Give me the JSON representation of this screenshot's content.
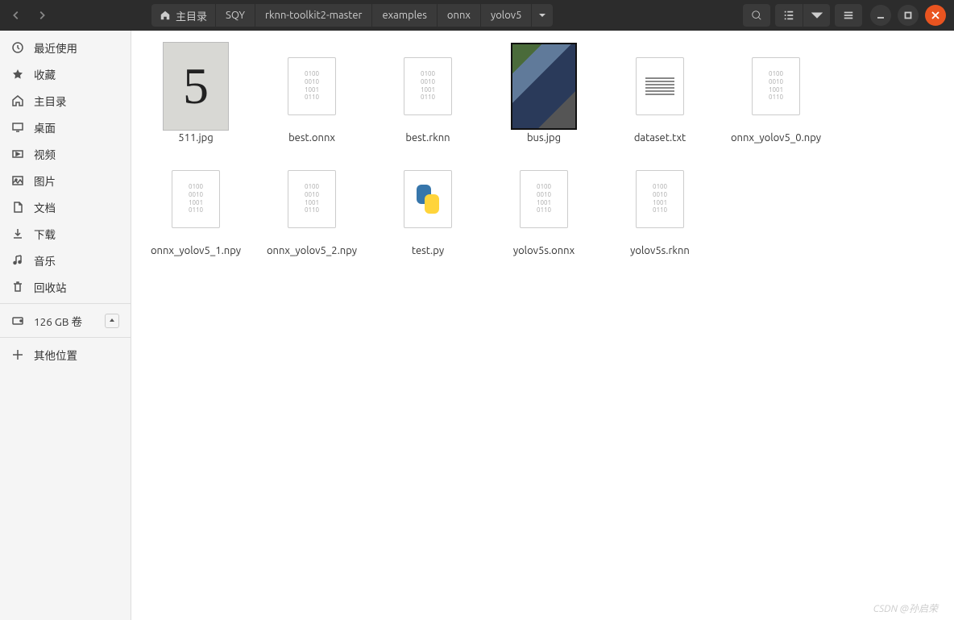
{
  "breadcrumb": {
    "home": "主目录",
    "items": [
      "SQY",
      "rknn-toolkit2-master",
      "examples",
      "onnx",
      "yolov5"
    ]
  },
  "sidebar": {
    "items": [
      {
        "id": "recent",
        "label": "最近使用",
        "icon": "clock"
      },
      {
        "id": "starred",
        "label": "收藏",
        "icon": "star"
      },
      {
        "id": "home",
        "label": "主目录",
        "icon": "home"
      },
      {
        "id": "desktop",
        "label": "桌面",
        "icon": "monitor"
      },
      {
        "id": "videos",
        "label": "视频",
        "icon": "video"
      },
      {
        "id": "pictures",
        "label": "图片",
        "icon": "image"
      },
      {
        "id": "documents",
        "label": "文档",
        "icon": "document"
      },
      {
        "id": "downloads",
        "label": "下载",
        "icon": "download"
      },
      {
        "id": "music",
        "label": "音乐",
        "icon": "music"
      },
      {
        "id": "trash",
        "label": "回收站",
        "icon": "trash"
      }
    ],
    "volume": {
      "label": "126 GB 卷",
      "icon": "disk"
    },
    "other": {
      "label": "其他位置",
      "icon": "plus"
    }
  },
  "files": [
    {
      "name": "511.jpg",
      "type": "image-5"
    },
    {
      "name": "best.onnx",
      "type": "binary"
    },
    {
      "name": "best.rknn",
      "type": "binary"
    },
    {
      "name": "bus.jpg",
      "type": "image-bus"
    },
    {
      "name": "dataset.txt",
      "type": "text"
    },
    {
      "name": "onnx_yolov5_0.npy",
      "type": "binary"
    },
    {
      "name": "onnx_yolov5_1.npy",
      "type": "binary"
    },
    {
      "name": "onnx_yolov5_2.npy",
      "type": "binary"
    },
    {
      "name": "test.py",
      "type": "python"
    },
    {
      "name": "yolov5s.onnx",
      "type": "binary"
    },
    {
      "name": "yolov5s.rknn",
      "type": "binary"
    }
  ],
  "watermark": "CSDN @孙启荣"
}
